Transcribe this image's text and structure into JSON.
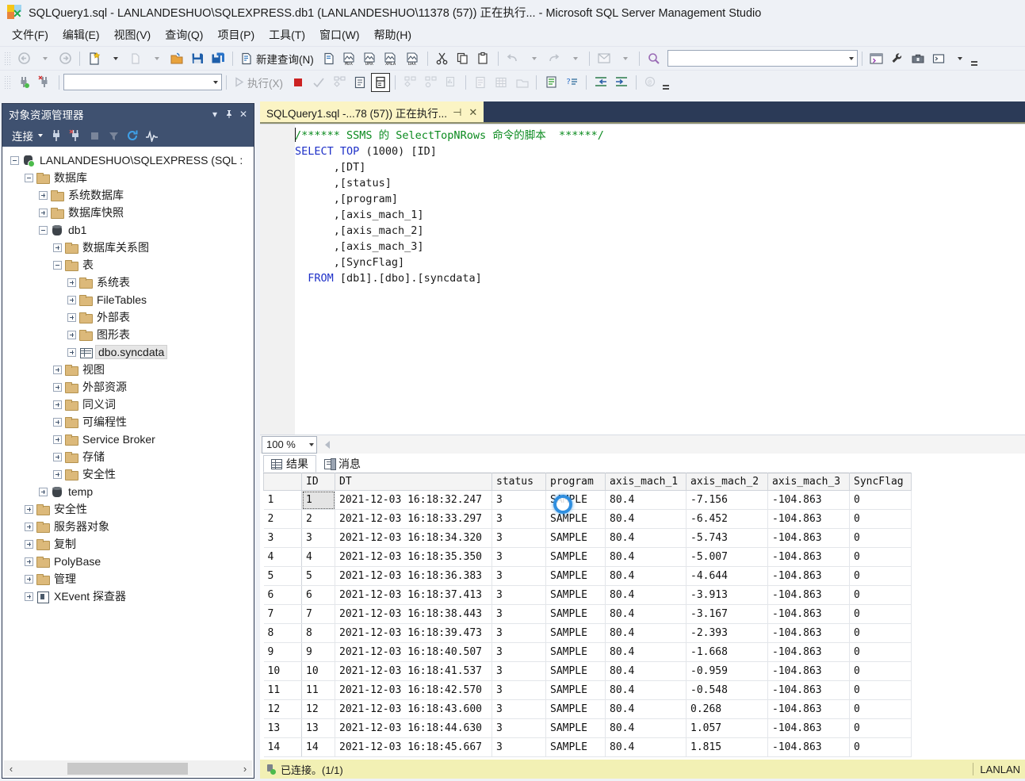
{
  "window": {
    "title": "SQLQuery1.sql - LANLANDESHUO\\SQLEXPRESS.db1 (LANLANDESHUO\\11378 (57)) 正在执行... - Microsoft SQL Server Management Studio",
    "logo_name": "ssms-logo"
  },
  "menu": [
    {
      "label": "文件(F)",
      "name": "menu-file"
    },
    {
      "label": "编辑(E)",
      "name": "menu-edit"
    },
    {
      "label": "视图(V)",
      "name": "menu-view"
    },
    {
      "label": "查询(Q)",
      "name": "menu-query"
    },
    {
      "label": "项目(P)",
      "name": "menu-project"
    },
    {
      "label": "工具(T)",
      "name": "menu-tools"
    },
    {
      "label": "窗口(W)",
      "name": "menu-window"
    },
    {
      "label": "帮助(H)",
      "name": "menu-help"
    }
  ],
  "toolbar1": {
    "new_query_label": "新建查询(N)",
    "search_placeholder": "",
    "search_value": "",
    "buttons": [
      "navigate-back",
      "navigate-forward",
      "new-query-dropdown",
      "new-project",
      "open-file",
      "save",
      "save-all",
      "new-query-with-current-connection",
      "new-analysis-query",
      "new-mdx-query",
      "new-dmx-query",
      "new-xmla-query",
      "new-dax-query",
      "cut",
      "copy",
      "paste",
      "undo",
      "redo",
      "object-explorer",
      "find-toolbar",
      "properties-window",
      "toolbox",
      "command-window"
    ]
  },
  "toolbar2": {
    "execute_label": "执行(X)",
    "database_value": "",
    "buttons": [
      "connect",
      "disconnect",
      "available-databases",
      "execute",
      "stop",
      "parse",
      "display-estimated-plan",
      "query-options",
      "include-actual-plan",
      "include-client-statistics",
      "results-to-text",
      "results-to-grid",
      "results-to-file",
      "comment-out",
      "uncomment",
      "decrease-indent",
      "increase-indent",
      "specify-values"
    ]
  },
  "object_explorer": {
    "title": "对象资源管理器",
    "connect_label": "连接",
    "header_buttons": [
      "dropdown-icon",
      "pin-icon",
      "close-icon"
    ],
    "toolbar_buttons": [
      "connect-icon",
      "disconnect-icon",
      "stop-icon",
      "filter-icon",
      "refresh-icon",
      "activity-monitor-icon"
    ],
    "tree": [
      {
        "label": "LANLANDESHUO\\SQLEXPRESS (SQL :",
        "indent": 0,
        "state": "minus",
        "icon": "server",
        "selected": false
      },
      {
        "label": "数据库",
        "indent": 1,
        "state": "minus",
        "icon": "folder",
        "selected": false
      },
      {
        "label": "系统数据库",
        "indent": 2,
        "state": "plus",
        "icon": "folder",
        "selected": false
      },
      {
        "label": "数据库快照",
        "indent": 2,
        "state": "plus",
        "icon": "folder",
        "selected": false
      },
      {
        "label": "db1",
        "indent": 2,
        "state": "minus",
        "icon": "db",
        "selected": false
      },
      {
        "label": "数据库关系图",
        "indent": 3,
        "state": "plus",
        "icon": "folder",
        "selected": false
      },
      {
        "label": "表",
        "indent": 3,
        "state": "minus",
        "icon": "folder",
        "selected": false
      },
      {
        "label": "系统表",
        "indent": 4,
        "state": "plus",
        "icon": "folder",
        "selected": false
      },
      {
        "label": "FileTables",
        "indent": 4,
        "state": "plus",
        "icon": "folder",
        "selected": false
      },
      {
        "label": "外部表",
        "indent": 4,
        "state": "plus",
        "icon": "folder",
        "selected": false
      },
      {
        "label": "图形表",
        "indent": 4,
        "state": "plus",
        "icon": "folder",
        "selected": false
      },
      {
        "label": "dbo.syncdata",
        "indent": 4,
        "state": "plus",
        "icon": "table",
        "selected": true
      },
      {
        "label": "视图",
        "indent": 3,
        "state": "plus",
        "icon": "folder",
        "selected": false
      },
      {
        "label": "外部资源",
        "indent": 3,
        "state": "plus",
        "icon": "folder",
        "selected": false
      },
      {
        "label": "同义词",
        "indent": 3,
        "state": "plus",
        "icon": "folder",
        "selected": false
      },
      {
        "label": "可编程性",
        "indent": 3,
        "state": "plus",
        "icon": "folder",
        "selected": false
      },
      {
        "label": "Service Broker",
        "indent": 3,
        "state": "plus",
        "icon": "folder",
        "selected": false
      },
      {
        "label": "存储",
        "indent": 3,
        "state": "plus",
        "icon": "folder",
        "selected": false
      },
      {
        "label": "安全性",
        "indent": 3,
        "state": "plus",
        "icon": "folder",
        "selected": false
      },
      {
        "label": "temp",
        "indent": 2,
        "state": "plus",
        "icon": "db",
        "selected": false
      },
      {
        "label": "安全性",
        "indent": 1,
        "state": "plus",
        "icon": "folder",
        "selected": false
      },
      {
        "label": "服务器对象",
        "indent": 1,
        "state": "plus",
        "icon": "folder",
        "selected": false
      },
      {
        "label": "复制",
        "indent": 1,
        "state": "plus",
        "icon": "folder",
        "selected": false
      },
      {
        "label": "PolyBase",
        "indent": 1,
        "state": "plus",
        "icon": "folder",
        "selected": false
      },
      {
        "label": "管理",
        "indent": 1,
        "state": "plus",
        "icon": "folder",
        "selected": false
      },
      {
        "label": "XEvent 探查器",
        "indent": 1,
        "state": "plus",
        "icon": "xevent",
        "selected": false
      }
    ]
  },
  "editor": {
    "tab_label": "SQLQuery1.sql -...78 (57)) 正在执行...",
    "tab_pin": "⊣",
    "tab_close": "✕",
    "code_lines": [
      {
        "text": "/****** SSMS 的 SelectTopNRows 命令的脚本  ******/",
        "kind": "comment"
      },
      {
        "text": "SELECT TOP (1000) [ID]",
        "kind": "select"
      },
      {
        "text": "      ,[DT]",
        "kind": "plain"
      },
      {
        "text": "      ,[status]",
        "kind": "plain"
      },
      {
        "text": "      ,[program]",
        "kind": "plain"
      },
      {
        "text": "      ,[axis_mach_1]",
        "kind": "plain"
      },
      {
        "text": "      ,[axis_mach_2]",
        "kind": "plain"
      },
      {
        "text": "      ,[axis_mach_3]",
        "kind": "plain"
      },
      {
        "text": "      ,[SyncFlag]",
        "kind": "plain"
      },
      {
        "text": "  FROM [db1].[dbo].[syncdata]",
        "kind": "from"
      }
    ]
  },
  "zoombar": {
    "zoom_value": "100 %"
  },
  "results": {
    "tabs": [
      {
        "label": "结果",
        "icon": "grid-icon",
        "active": true,
        "name": "tab-results"
      },
      {
        "label": "消息",
        "icon": "message-icon",
        "active": false,
        "name": "tab-messages"
      }
    ],
    "columns": [
      "",
      "ID",
      "DT",
      "status",
      "program",
      "axis_mach_1",
      "axis_mach_2",
      "axis_mach_3",
      "SyncFlag"
    ],
    "rows": [
      [
        "1",
        "1",
        "2021-12-03 16:18:32.247",
        "3",
        "SAMPLE",
        "80.4",
        "-7.156",
        "-104.863",
        "0"
      ],
      [
        "2",
        "2",
        "2021-12-03 16:18:33.297",
        "3",
        "SAMPLE",
        "80.4",
        "-6.452",
        "-104.863",
        "0"
      ],
      [
        "3",
        "3",
        "2021-12-03 16:18:34.320",
        "3",
        "SAMPLE",
        "80.4",
        "-5.743",
        "-104.863",
        "0"
      ],
      [
        "4",
        "4",
        "2021-12-03 16:18:35.350",
        "3",
        "SAMPLE",
        "80.4",
        "-5.007",
        "-104.863",
        "0"
      ],
      [
        "5",
        "5",
        "2021-12-03 16:18:36.383",
        "3",
        "SAMPLE",
        "80.4",
        "-4.644",
        "-104.863",
        "0"
      ],
      [
        "6",
        "6",
        "2021-12-03 16:18:37.413",
        "3",
        "SAMPLE",
        "80.4",
        "-3.913",
        "-104.863",
        "0"
      ],
      [
        "7",
        "7",
        "2021-12-03 16:18:38.443",
        "3",
        "SAMPLE",
        "80.4",
        "-3.167",
        "-104.863",
        "0"
      ],
      [
        "8",
        "8",
        "2021-12-03 16:18:39.473",
        "3",
        "SAMPLE",
        "80.4",
        "-2.393",
        "-104.863",
        "0"
      ],
      [
        "9",
        "9",
        "2021-12-03 16:18:40.507",
        "3",
        "SAMPLE",
        "80.4",
        "-1.668",
        "-104.863",
        "0"
      ],
      [
        "10",
        "10",
        "2021-12-03 16:18:41.537",
        "3",
        "SAMPLE",
        "80.4",
        "-0.959",
        "-104.863",
        "0"
      ],
      [
        "11",
        "11",
        "2021-12-03 16:18:42.570",
        "3",
        "SAMPLE",
        "80.4",
        "-0.548",
        "-104.863",
        "0"
      ],
      [
        "12",
        "12",
        "2021-12-03 16:18:43.600",
        "3",
        "SAMPLE",
        "80.4",
        "0.268",
        "-104.863",
        "0"
      ],
      [
        "13",
        "13",
        "2021-12-03 16:18:44.630",
        "3",
        "SAMPLE",
        "80.4",
        "1.057",
        "-104.863",
        "0"
      ],
      [
        "14",
        "14",
        "2021-12-03 16:18:45.667",
        "3",
        "SAMPLE",
        "80.4",
        "1.815",
        "-104.863",
        "0"
      ]
    ],
    "selected_cell": {
      "row": 0,
      "col": 1
    }
  },
  "statusbar": {
    "connection_text": "已连接。(1/1)",
    "right_text": "LANLAN"
  },
  "colors": {
    "accent_navy": "#2b3a57",
    "oe_header": "#3f5170",
    "tab_yellow": "#fbf4c4",
    "status_yellow": "#f2f0b4",
    "comment_green": "#0a8a1e",
    "keyword_blue": "#1e30c8",
    "click_marker": "#2f8fe0"
  }
}
